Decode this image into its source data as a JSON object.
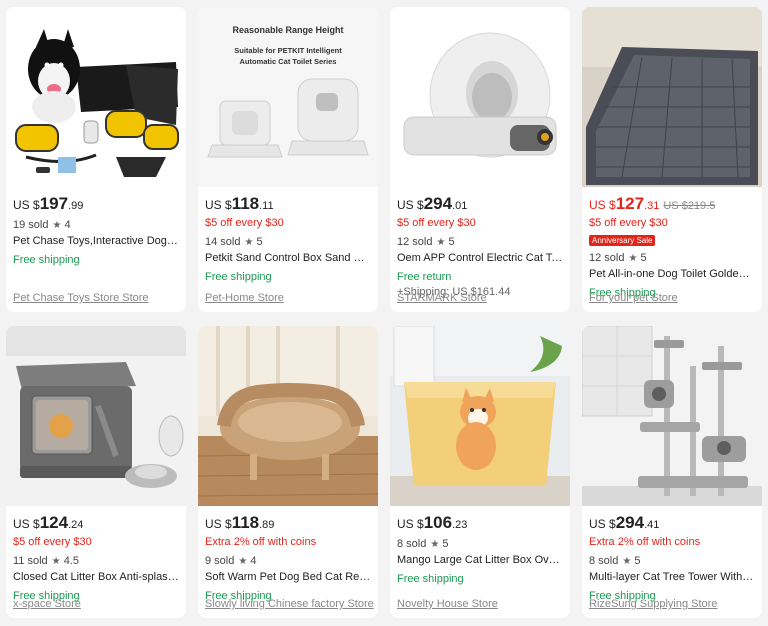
{
  "products": [
    {
      "currency": "US $",
      "price_int": "197",
      "price_dec": ".99",
      "original_price": "",
      "promo": "",
      "badge": "",
      "sold": "19 sold",
      "rating": "4",
      "title": "Pet Chase Toys,Interactive Dog Toys",
      "shipping": "Free shipping",
      "shipping_extra": "",
      "store": "Pet Chase Toys Store Store"
    },
    {
      "currency": "US $",
      "price_int": "118",
      "price_dec": ".11",
      "original_price": "",
      "promo": "$5 off every $30",
      "badge": "",
      "sold": "14 sold",
      "rating": "5",
      "title": "Petkit Sand Control Box Sand Control Mat",
      "shipping": "Free shipping",
      "shipping_extra": "",
      "store": "Pet-Home Store",
      "image_text_1": "Reasonable Range Height",
      "image_text_2": "Suitable for PETKIT Intelligent",
      "image_text_3": "Automatic Cat Toilet Series"
    },
    {
      "currency": "US $",
      "price_int": "294",
      "price_dec": ".01",
      "original_price": "",
      "promo": "$5 off every $30",
      "badge": "",
      "sold": "12 sold",
      "rating": "5",
      "title": "Oem APP Control Electric Cat Toilet Self Cleaning",
      "shipping": "Free return",
      "shipping_extra": "+Shipping: US $161.44",
      "store": "STARMARK Store"
    },
    {
      "currency": "US $",
      "price_int": "127",
      "price_dec": ".31",
      "original_price": "US $219.5",
      "promo": "$5 off every $30",
      "badge": "Anniversary Sale",
      "sold": "12 sold",
      "rating": "5",
      "title": "Pet All-in-one Dog Toilet Golden Retriever",
      "shipping": "Free shipping",
      "shipping_extra": "",
      "store": "For your pet Store"
    },
    {
      "currency": "US $",
      "price_int": "124",
      "price_dec": ".24",
      "original_price": "",
      "promo": "$5 off every $30",
      "badge": "",
      "sold": "11 sold",
      "rating": "4.5",
      "title": "Closed Cat Litter Box Anti-splash Large Space",
      "shipping": "Free shipping",
      "shipping_extra": "",
      "store": "x-space Store"
    },
    {
      "currency": "US $",
      "price_int": "118",
      "price_dec": ".89",
      "original_price": "",
      "promo": "Extra 2% off with coins",
      "badge": "",
      "sold": "9 sold",
      "rating": "4",
      "title": "Soft Warm Pet Dog Bed Cat Removable Sofa",
      "shipping": "Free shipping",
      "shipping_extra": "",
      "store": "Slowly living Chinese factory Store"
    },
    {
      "currency": "US $",
      "price_int": "106",
      "price_dec": ".23",
      "original_price": "",
      "promo": "",
      "badge": "",
      "sold": "8 sold",
      "rating": "5",
      "title": "Mango Large Cat Litter Box Oversized Semi-closed",
      "shipping": "Free shipping",
      "shipping_extra": "",
      "store": "Novelty House Store"
    },
    {
      "currency": "US $",
      "price_int": "294",
      "price_dec": ".41",
      "original_price": "",
      "promo": "Extra 2% off with coins",
      "badge": "",
      "sold": "8 sold",
      "rating": "5",
      "title": "Multi-layer Cat Tree Tower With Condo Scratching Post",
      "shipping": "Free shipping",
      "shipping_extra": "",
      "store": "RizeSung Supplying Store"
    }
  ],
  "colors": {
    "price_red": "#e1251b",
    "shipping_green": "#1a9a52",
    "store_gray": "#888888"
  },
  "icons": {
    "rating": "star-icon"
  }
}
